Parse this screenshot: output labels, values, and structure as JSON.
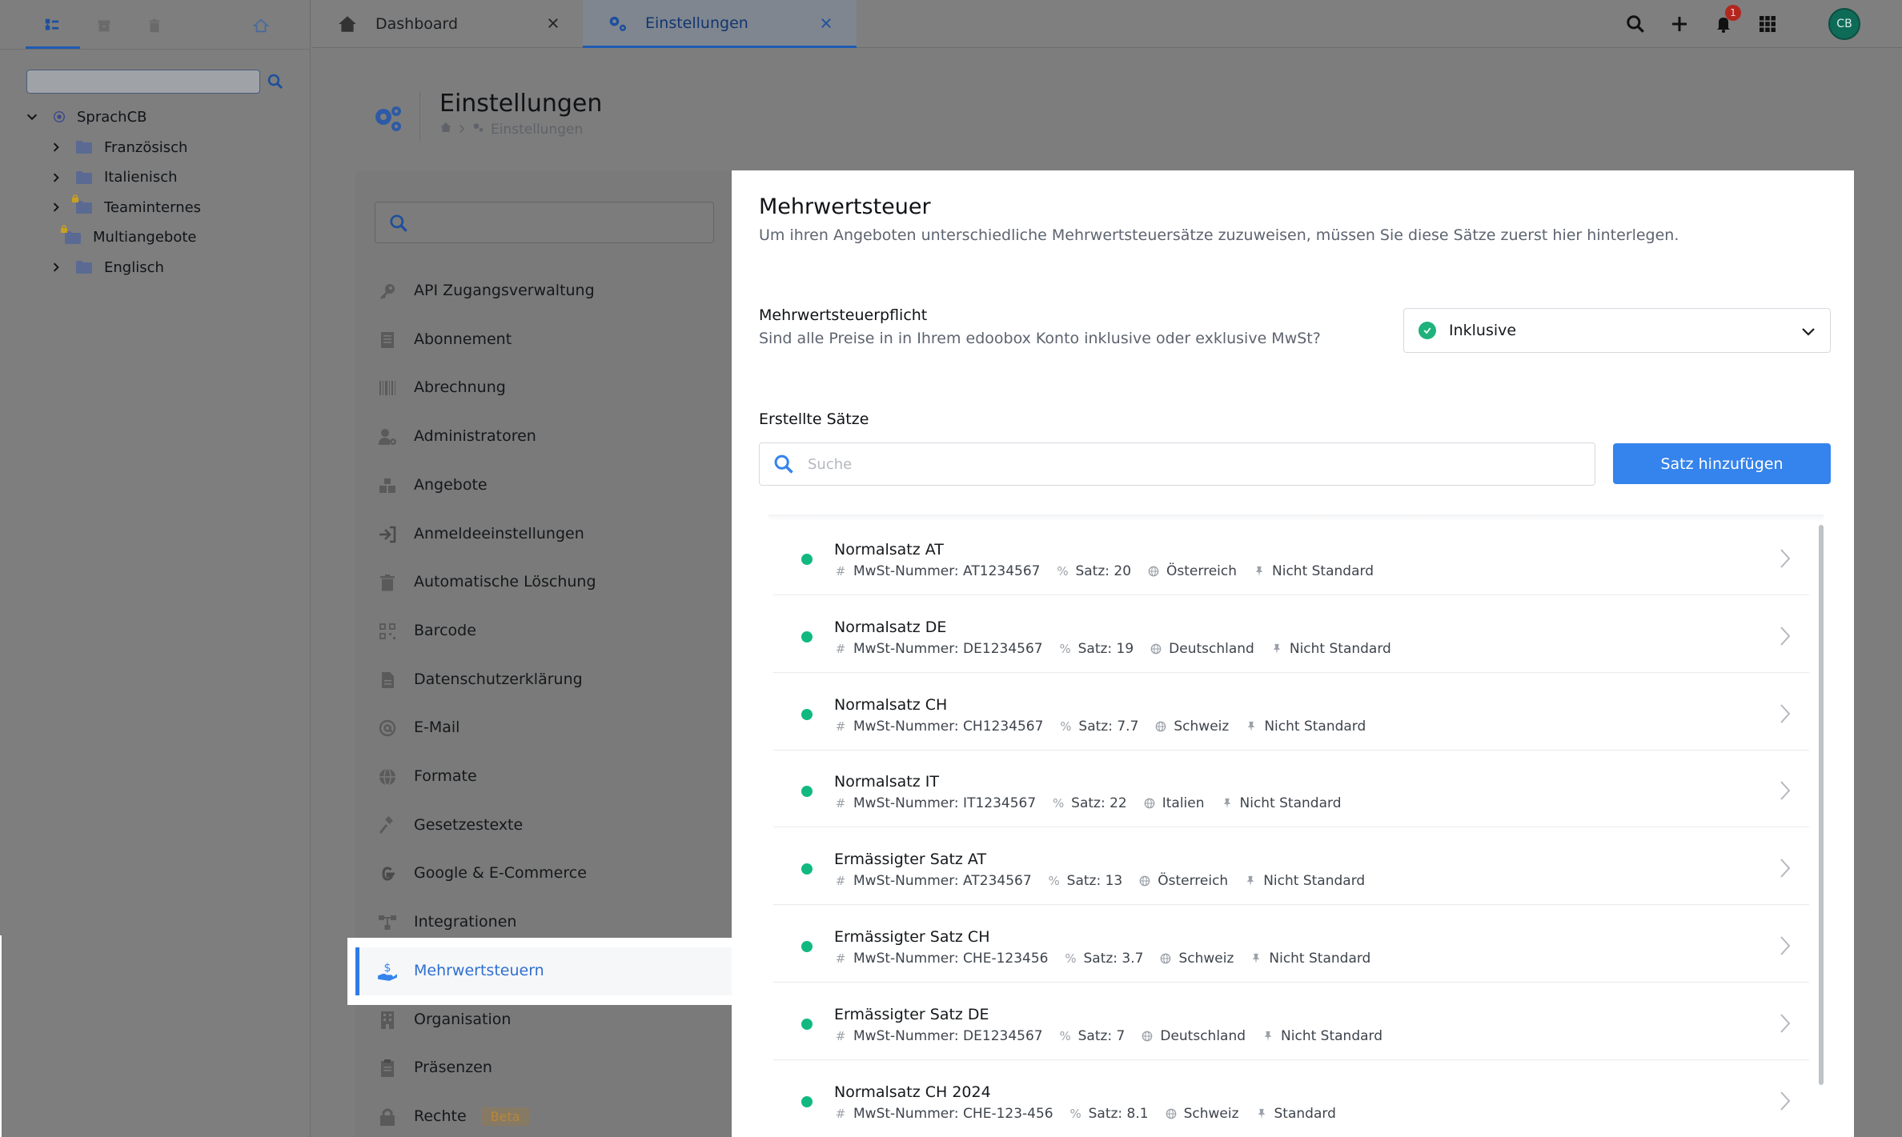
{
  "tree": {
    "root": "SprachCB",
    "items": [
      {
        "label": "Französisch",
        "expandable": true,
        "locked": false
      },
      {
        "label": "Italienisch",
        "expandable": true,
        "locked": false
      },
      {
        "label": "Teaminternes",
        "expandable": true,
        "locked": true
      },
      {
        "label": "Multiangebote",
        "expandable": false,
        "locked": true
      },
      {
        "label": "Englisch",
        "expandable": true,
        "locked": false
      }
    ]
  },
  "tabs": {
    "dashboard": "Dashboard",
    "settings": "Einstellungen"
  },
  "topbar": {
    "notification_count": "1",
    "avatar_initials": "CB"
  },
  "page": {
    "title": "Einstellungen",
    "breadcrumb": "Einstellungen"
  },
  "nav": {
    "items": [
      {
        "label": "API Zugangsverwaltung",
        "icon": "key-icon"
      },
      {
        "label": "Abonnement",
        "icon": "document-icon"
      },
      {
        "label": "Abrechnung",
        "icon": "barcode-icon"
      },
      {
        "label": "Administratoren",
        "icon": "user-gear-icon"
      },
      {
        "label": "Angebote",
        "icon": "boxes-icon"
      },
      {
        "label": "Anmeldeeinstellungen",
        "icon": "sign-in-icon"
      },
      {
        "label": "Automatische Löschung",
        "icon": "trash-icon"
      },
      {
        "label": "Barcode",
        "icon": "qr-icon"
      },
      {
        "label": "Datenschutzerklärung",
        "icon": "file-icon"
      },
      {
        "label": "E-Mail",
        "icon": "at-icon"
      },
      {
        "label": "Formate",
        "icon": "globe-icon"
      },
      {
        "label": "Gesetzestexte",
        "icon": "gavel-icon"
      },
      {
        "label": "Google & E-Commerce",
        "icon": "google-icon"
      },
      {
        "label": "Integrationen",
        "icon": "network-icon"
      },
      {
        "label": "Mehrwertsteuern",
        "icon": "hand-dollar-icon"
      },
      {
        "label": "Organisation",
        "icon": "building-icon"
      },
      {
        "label": "Präsenzen",
        "icon": "clipboard-icon"
      },
      {
        "label": "Rechte",
        "icon": "lock-icon",
        "badge": "Beta"
      }
    ],
    "active_index": 14
  },
  "main": {
    "title": "Mehrwertsteuer",
    "subtitle": "Um ihren Angeboten unterschiedliche Mehrwertsteuersätze zuzuweisen, müssen Sie diese Sätze zuerst hier hinterlegen.",
    "tax_obligation_label": "Mehrwertsteuerpflicht",
    "tax_obligation_sub": "Sind alle Preise in in Ihrem edoobox Konto inklusive oder exklusive MwSt?",
    "tax_obligation_value": "Inklusive",
    "rates_label": "Erstellte Sätze",
    "search_placeholder": "Suche",
    "add_button": "Satz hinzufügen"
  },
  "rates": [
    {
      "name": "Normalsatz AT",
      "vat": "MwSt-Nummer: AT1234567",
      "rate": "Satz: 20",
      "country": "Österreich",
      "standard": "Nicht Standard"
    },
    {
      "name": "Normalsatz DE",
      "vat": "MwSt-Nummer: DE1234567",
      "rate": "Satz: 19",
      "country": "Deutschland",
      "standard": "Nicht Standard"
    },
    {
      "name": "Normalsatz CH",
      "vat": "MwSt-Nummer: CH1234567",
      "rate": "Satz: 7.7",
      "country": "Schweiz",
      "standard": "Nicht Standard"
    },
    {
      "name": "Normalsatz IT",
      "vat": "MwSt-Nummer: IT1234567",
      "rate": "Satz: 22",
      "country": "Italien",
      "standard": "Nicht Standard"
    },
    {
      "name": "Ermässigter Satz AT",
      "vat": "MwSt-Nummer: AT234567",
      "rate": "Satz: 13",
      "country": "Österreich",
      "standard": "Nicht Standard"
    },
    {
      "name": "Ermässigter Satz CH",
      "vat": "MwSt-Nummer: CHE-123456",
      "rate": "Satz: 3.7",
      "country": "Schweiz",
      "standard": "Nicht Standard"
    },
    {
      "name": "Ermässigter Satz DE",
      "vat": "MwSt-Nummer: DE1234567",
      "rate": "Satz: 7",
      "country": "Deutschland",
      "standard": "Nicht Standard"
    },
    {
      "name": "Normalsatz CH 2024",
      "vat": "MwSt-Nummer: CHE-123-456",
      "rate": "Satz: 8.1",
      "country": "Schweiz",
      "standard": "Standard"
    }
  ],
  "colors": {
    "accent": "#3583ec",
    "active_status": "#11b981",
    "overlay_gray": "#7e7e7e"
  }
}
